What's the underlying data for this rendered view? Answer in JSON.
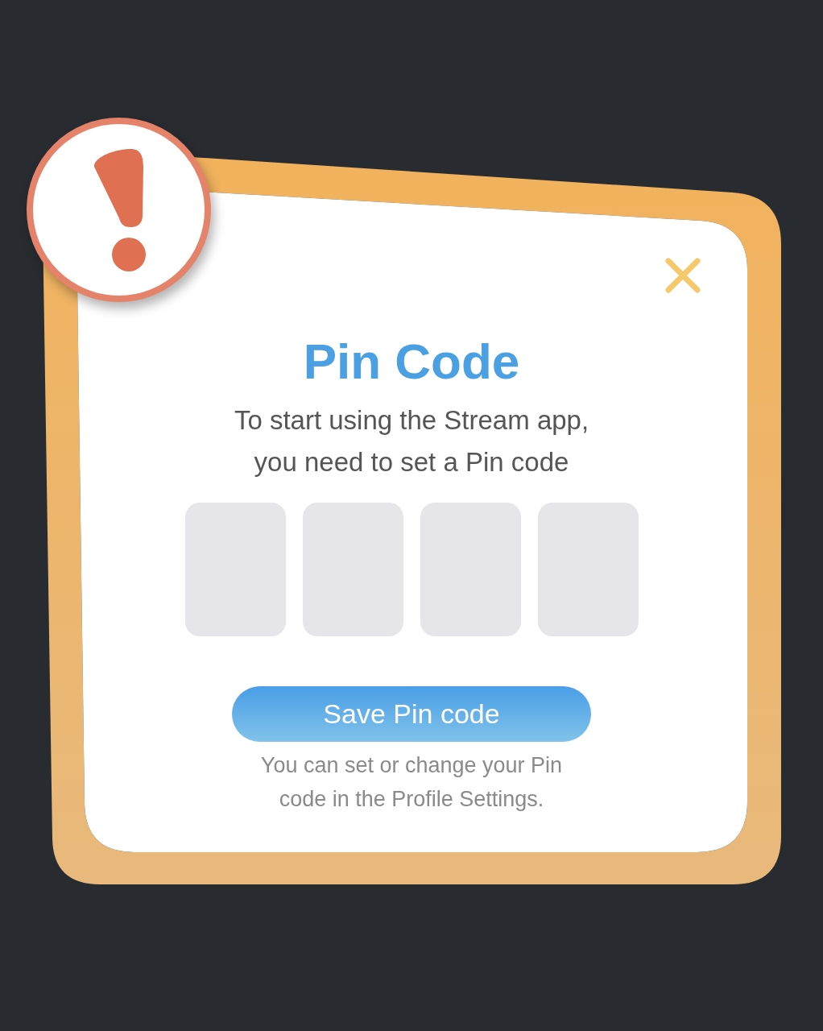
{
  "dialog": {
    "title": "Pin Code",
    "message": "To start using the Stream app,\nyou need to set a Pin code",
    "pin_boxes": [
      {
        "filled": false
      },
      {
        "filled": false
      },
      {
        "filled": false
      },
      {
        "filled": false
      }
    ],
    "primary_button": "Save Pin code",
    "note": "You can set or change your Pin\ncode in the Profile Settings."
  }
}
